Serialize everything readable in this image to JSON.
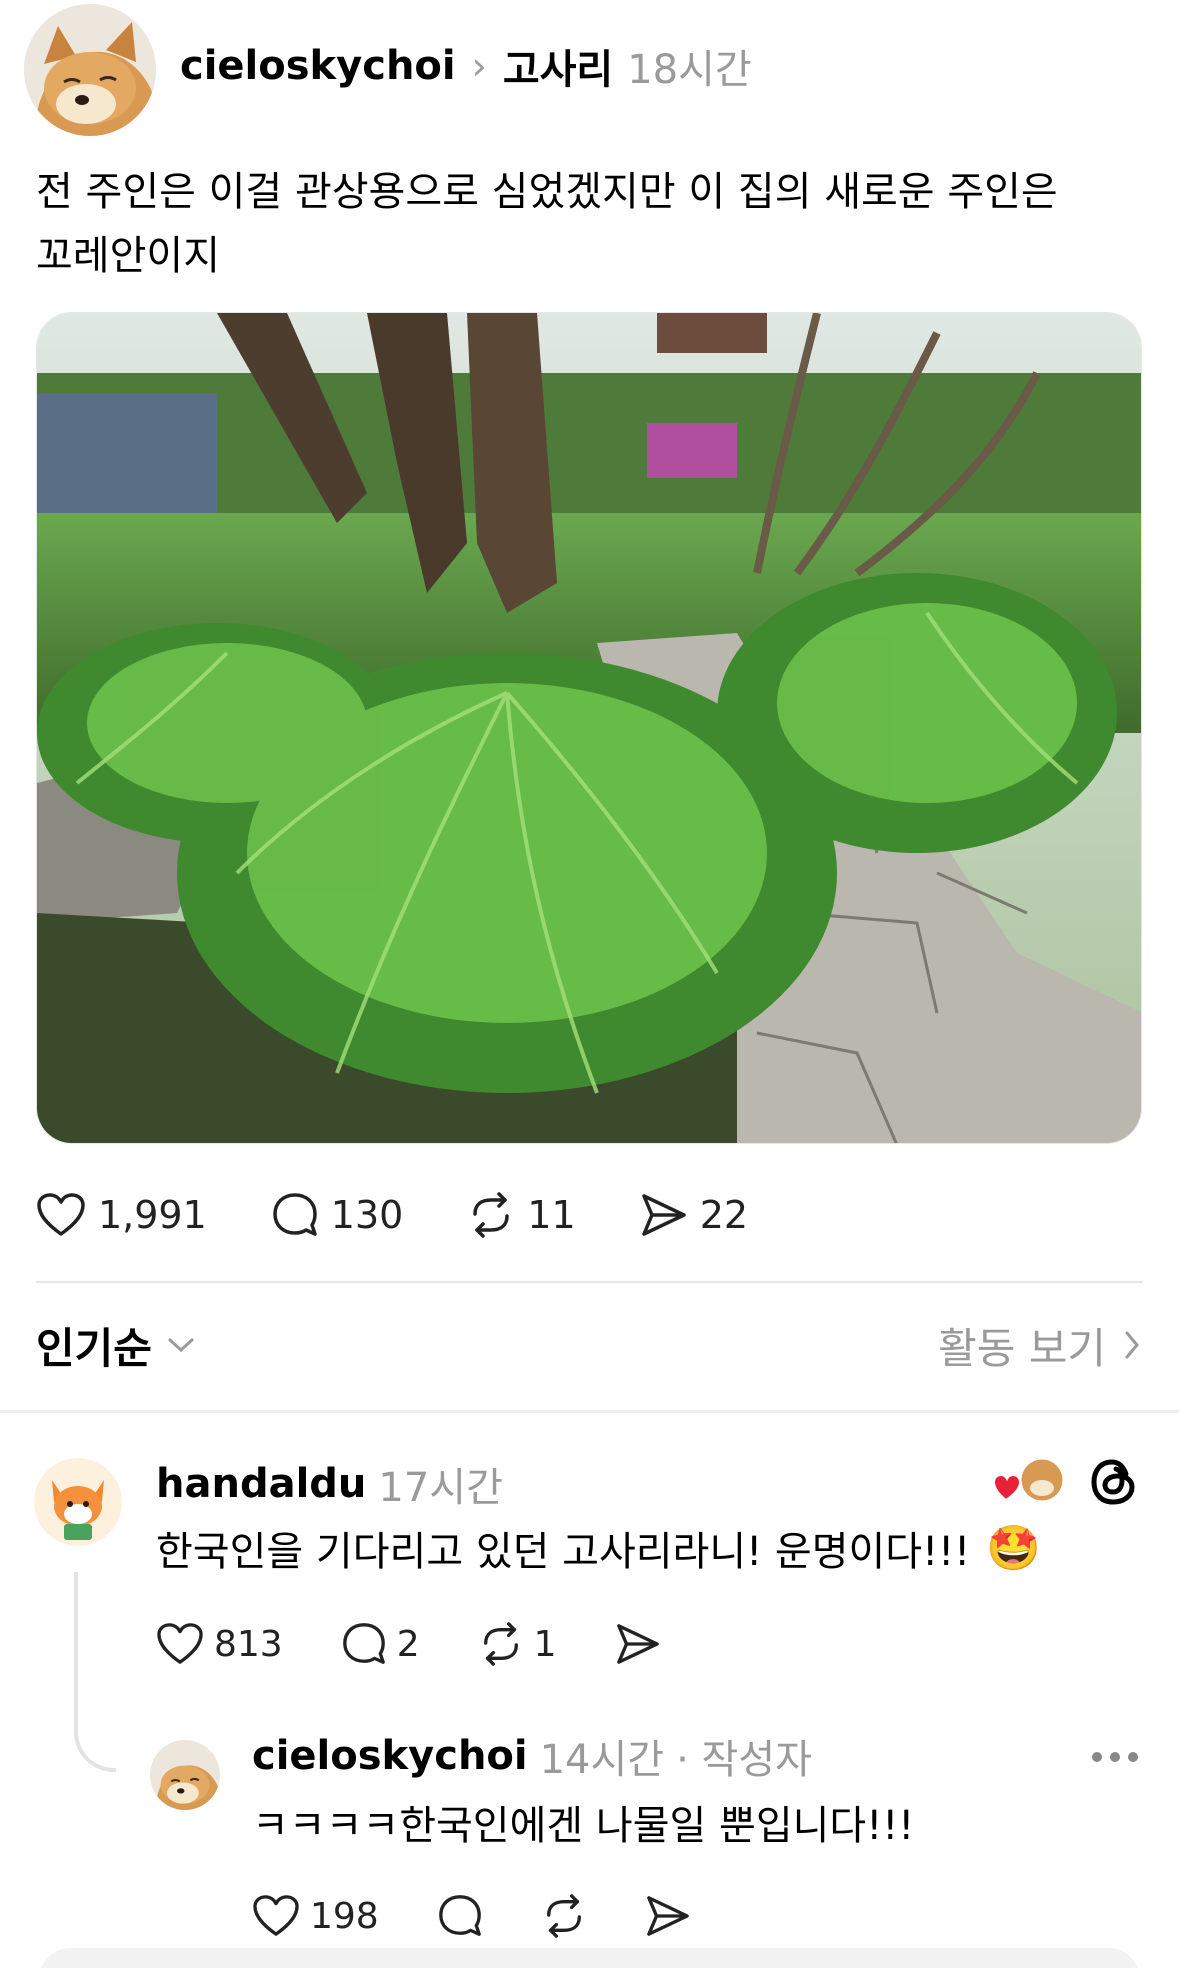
{
  "post": {
    "username": "cieloskychoi",
    "separator": "›",
    "topic": "고사리",
    "time": "18시간",
    "text": "전 주인은 이걸 관상용으로 심었겠지만 이 집의 새로운 주인은\n꼬레안이지",
    "image_label": "fern-garden-photo",
    "likes": "1,991",
    "replies": "130",
    "reposts": "11",
    "shares": "22"
  },
  "sort": {
    "label": "인기순",
    "activity_label": "활동 보기"
  },
  "comments": [
    {
      "username": "handaldu",
      "time": "17시간",
      "text": "한국인을 기다리고 있던 고사리라니! 운명이다!!!",
      "emoji": "🤩",
      "likes": "813",
      "replies": "2",
      "reposts": "1"
    },
    {
      "username": "cieloskychoi",
      "time": "14시간",
      "author_tag": "· 작성자",
      "text": "ㅋㅋㅋㅋ한국인에겐 나물일 뿐입니다!!!",
      "likes": "198"
    }
  ],
  "colors": {
    "muted": "#9a9a9a",
    "divider": "#e5e5e5",
    "heart_red": "#e8213b"
  }
}
